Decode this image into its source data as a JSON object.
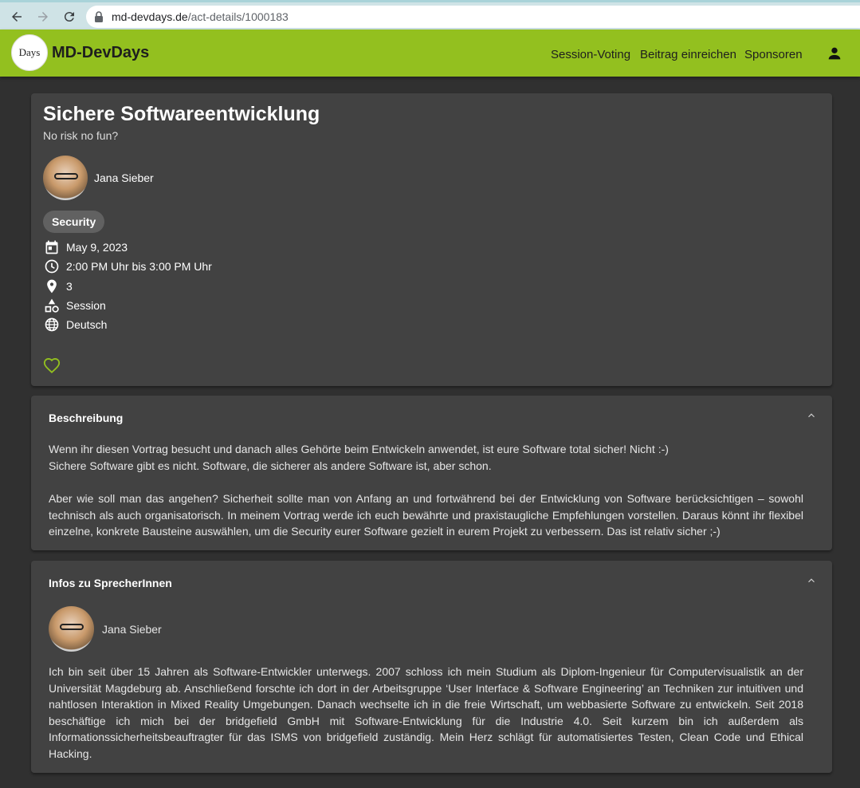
{
  "browser": {
    "url_host": "md-devdays.de",
    "url_path": "/act-details/1000183"
  },
  "header": {
    "logo_text": "Days",
    "brand": "MD-DevDays",
    "nav": [
      "Session-Voting",
      "Beitrag einreichen",
      "Sponsoren"
    ]
  },
  "talk": {
    "title": "Sichere Softwareentwicklung",
    "subtitle": "No risk no fun?",
    "speaker": "Jana Sieber",
    "tag": "Security",
    "date": "May 9, 2023",
    "time": "2:00 PM Uhr bis 3:00 PM Uhr",
    "room": "3",
    "format": "Session",
    "language": "Deutsch"
  },
  "description": {
    "title": "Beschreibung",
    "line1": "Wenn ihr diesen Vortrag besucht und danach alles Gehörte beim Entwickeln anwendet, ist eure Software total sicher! Nicht :-)",
    "line2": "Sichere Software gibt es nicht. Software, die sicherer als andere Software ist, aber schon.",
    "paragraph": "Aber wie soll man das angehen? Sicherheit sollte man von Anfang an und fortwährend bei der Entwicklung von Software berücksichtigen – sowohl technisch als auch organisatorisch. In meinem Vortrag werde ich euch bewährte und praxistaugliche Empfehlungen vorstellen. Daraus könnt ihr flexibel einzelne, konkrete Bausteine auswählen, um die Security eurer Software gezielt in eurem Projekt zu verbessern. Das ist relativ sicher ;-)"
  },
  "speakers": {
    "title": "Infos zu SprecherInnen",
    "name": "Jana Sieber",
    "bio": "Ich bin seit über 15 Jahren als Software-Entwickler unterwegs. 2007 schloss ich mein Studium als Diplom-Ingenieur für Computervisualistik an der Universität Magdeburg ab. Anschließend forschte ich dort in der Arbeitsgruppe ‘User Interface & Software Engineering’ an Techniken zur intuitiven und nahtlosen Interaktion in Mixed Reality Umgebungen. Danach wechselte ich in die freie Wirtschaft, um webbasierte Software zu entwickeln. Seit 2018 beschäftige ich mich bei der bridgefield GmbH mit Software-Entwicklung für die Industrie 4.0. Seit kurzem bin ich außerdem als Informationssicherheitsbeauftragter für das ISMS von bridgefield zuständig. Mein Herz schlägt für automatisiertes Testen, Clean Code und Ethical Hacking."
  },
  "colors": {
    "header_bg": "#93c01f",
    "page_bg": "#303030",
    "card_bg": "#424242",
    "chip_bg": "#616161",
    "heart": "#93c01f"
  }
}
